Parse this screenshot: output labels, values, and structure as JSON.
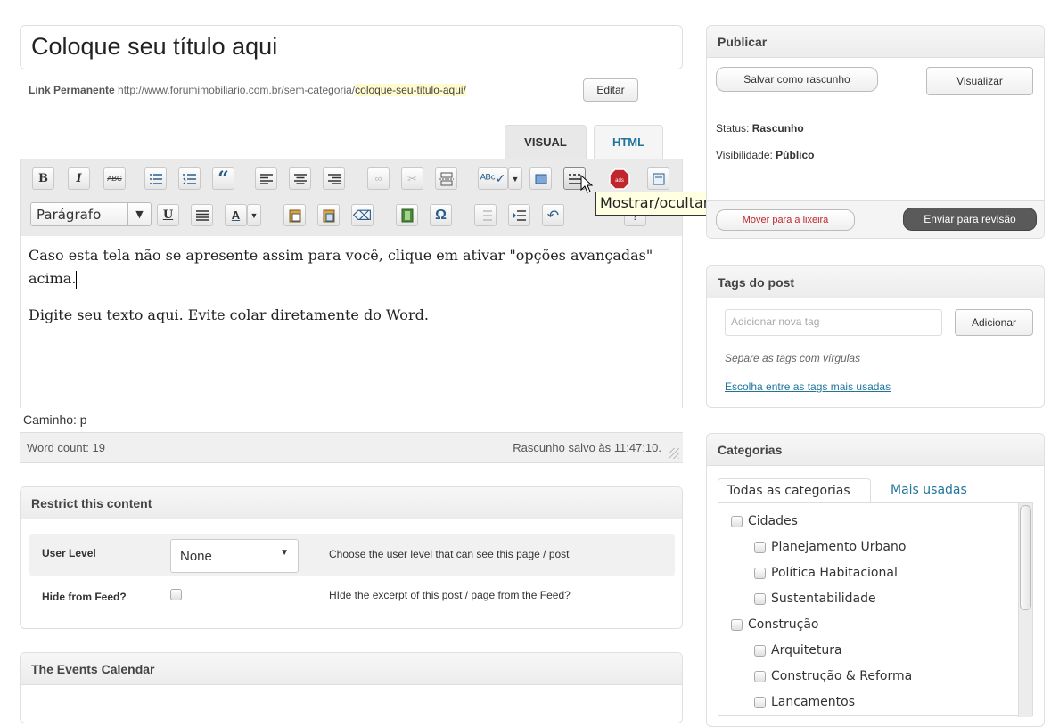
{
  "title": {
    "value": "Coloque seu título aqui"
  },
  "permalink": {
    "label": "Link Permanente",
    "base": "http://www.forumimobiliario.com.br/sem-categoria/",
    "slug": "coloque-seu-titulo-aqui/",
    "edit_label": "Editar"
  },
  "editor_tabs": {
    "visual": "VISUAL",
    "html": "HTML"
  },
  "toolbar": {
    "bold": "B",
    "italic": "I",
    "strike": "ABC",
    "quote": "“",
    "format_select": "Parágrafo",
    "underline": "U",
    "omega": "Ω"
  },
  "tooltip": "Mostrar/ocultar opções avançadas (Alt+Shift+Z)",
  "content": {
    "p1": "Caso esta tela não se apresente assim para você, clique em ativar \"opções avançadas\" acima.",
    "p2": "Digite seu texto aqui. Evite colar diretamente do Word."
  },
  "path": "Caminho: p",
  "word_count": "Word count: 19",
  "draft_saved": "Rascunho salvo às 11:47:10.",
  "restrict": {
    "title": "Restrict this content",
    "user_level_label": "User Level",
    "user_level_value": "None",
    "user_level_help": "Choose the user level that can see this page / post",
    "hide_feed_label": "Hide from Feed?",
    "hide_feed_help": "HIde the excerpt of this post / page from the Feed?"
  },
  "events": {
    "title": "The Events Calendar"
  },
  "publish": {
    "title": "Publicar",
    "save_draft": "Salvar como rascunho",
    "preview": "Visualizar",
    "status_label": "Status:",
    "status_value": "Rascunho",
    "visibility_label": "Visibilidade:",
    "visibility_value": "Público",
    "trash": "Mover para a lixeira",
    "submit": "Enviar para revisão"
  },
  "tags": {
    "title": "Tags do post",
    "placeholder": "Adicionar nova tag",
    "add_label": "Adicionar",
    "hint": "Separe as tags com vírgulas",
    "choose_link": "Escolha entre as tags mais usadas"
  },
  "categories": {
    "title": "Categorias",
    "tab_all": "Todas as categorias",
    "tab_popular": "Mais usadas",
    "items": [
      {
        "label": "Cidades",
        "level": 0
      },
      {
        "label": "Planejamento Urbano",
        "level": 1
      },
      {
        "label": "Política Habitacional",
        "level": 1
      },
      {
        "label": "Sustentabilidade",
        "level": 1
      },
      {
        "label": "Construção",
        "level": 0
      },
      {
        "label": "Arquitetura",
        "level": 1
      },
      {
        "label": "Construção & Reforma",
        "level": 1
      },
      {
        "label": "Lancamentos",
        "level": 1
      }
    ]
  },
  "colors": {
    "accent": "#21759b",
    "tooltip_bg": "#ffffe1",
    "submit_bg": "#5a5a5a"
  }
}
